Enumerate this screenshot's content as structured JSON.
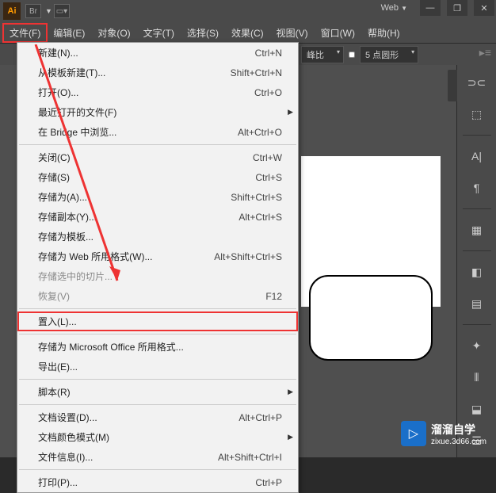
{
  "titlebar": {
    "app_icon": "Ai",
    "br_icon": "Br",
    "web_label": "Web",
    "web_arrow": "▼",
    "min": "—",
    "restore": "❐",
    "close": "✕"
  },
  "menubar": {
    "items": [
      "文件(F)",
      "编辑(E)",
      "对象(O)",
      "文字(T)",
      "选择(S)",
      "效果(C)",
      "视图(V)",
      "窗口(W)",
      "帮助(H)"
    ]
  },
  "toolbar": {
    "prefs_label": "峰比",
    "stroke_label": "5 点圆形"
  },
  "dropdown": {
    "items": [
      {
        "label": "新建(N)...",
        "shortcut": "Ctrl+N"
      },
      {
        "label": "从模板新建(T)...",
        "shortcut": "Shift+Ctrl+N"
      },
      {
        "label": "打开(O)...",
        "shortcut": "Ctrl+O"
      },
      {
        "label": "最近打开的文件(F)",
        "shortcut": "",
        "arrow": true
      },
      {
        "label": "在 Bridge 中浏览...",
        "shortcut": "Alt+Ctrl+O"
      },
      {
        "sep": true
      },
      {
        "label": "关闭(C)",
        "shortcut": "Ctrl+W"
      },
      {
        "label": "存储(S)",
        "shortcut": "Ctrl+S"
      },
      {
        "label": "存储为(A)...",
        "shortcut": "Shift+Ctrl+S"
      },
      {
        "label": "存储副本(Y)...",
        "shortcut": "Alt+Ctrl+S"
      },
      {
        "label": "存储为模板...",
        "shortcut": ""
      },
      {
        "label": "存储为 Web 所用格式(W)...",
        "shortcut": "Alt+Shift+Ctrl+S"
      },
      {
        "label": "存储选中的切片...",
        "shortcut": "",
        "disabled": true
      },
      {
        "label": "恢复(V)",
        "shortcut": "F12",
        "disabled": true
      },
      {
        "sep": true
      },
      {
        "label": "置入(L)...",
        "shortcut": "",
        "highlighted": true
      },
      {
        "sep": true
      },
      {
        "label": "存储为 Microsoft Office 所用格式...",
        "shortcut": ""
      },
      {
        "label": "导出(E)...",
        "shortcut": ""
      },
      {
        "sep": true
      },
      {
        "label": "脚本(R)",
        "shortcut": "",
        "arrow": true
      },
      {
        "sep": true
      },
      {
        "label": "文档设置(D)...",
        "shortcut": "Alt+Ctrl+P"
      },
      {
        "label": "文档颜色模式(M)",
        "shortcut": "",
        "arrow": true
      },
      {
        "label": "文件信息(I)...",
        "shortcut": "Alt+Shift+Ctrl+I"
      },
      {
        "sep": true
      },
      {
        "label": "打印(P)...",
        "shortcut": "Ctrl+P"
      }
    ]
  },
  "watermark": {
    "cn": "溜溜自学",
    "url": "zixue.3d66.com"
  }
}
